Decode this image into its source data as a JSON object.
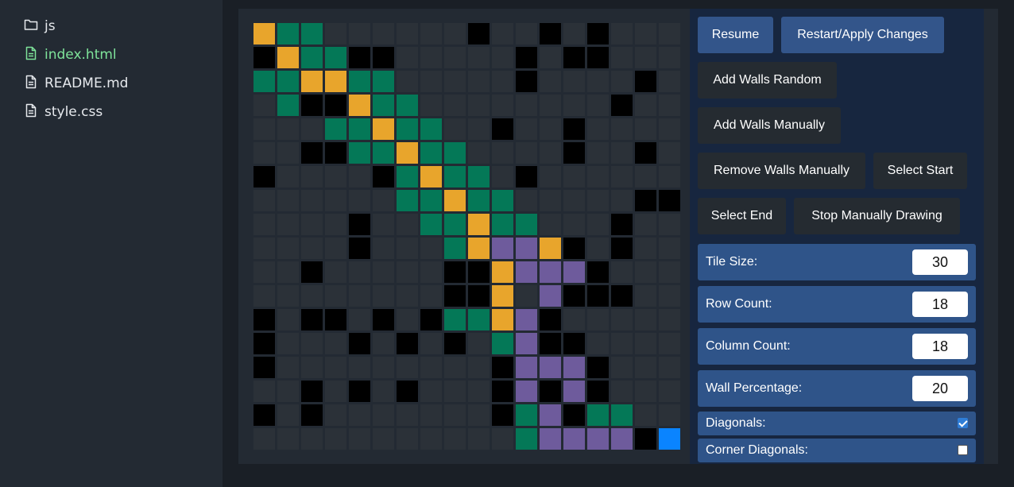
{
  "sidebar": {
    "files": [
      {
        "name": "js",
        "icon": "folder-icon",
        "active": false
      },
      {
        "name": "index.html",
        "icon": "file-icon",
        "active": true
      },
      {
        "name": "README.md",
        "icon": "file-icon",
        "active": false
      },
      {
        "name": "style.css",
        "icon": "file-icon",
        "active": false
      }
    ]
  },
  "colors": {
    "empty": "#2b3138",
    "wall": "#000000",
    "visited": "#047857",
    "path": "#e8a52c",
    "frontier": "#6e5b9c",
    "end": "#0a84ff"
  },
  "grid": {
    "legend": {
      ".": "empty",
      "#": "wall",
      "g": "visited",
      "o": "path",
      "p": "frontier",
      "E": "end"
    },
    "rows": [
      "ogg......#..#.#..",
      "#ogg##.....#.##.",
      "ggoogg.....#....#.",
      ".g##ogg........#..",
      "...ggogg..#..#....",
      "..##ggogg....#..#.",
      "#....#gogg.#......",
      "......ggogg.....##",
      "....#..ggogg...#..",
      "....#...goppo#.#..",
      "..#.....##oppp#...",
      "........##o.p###..",
      "#.##.#.#ggop#.....",
      "#...#.#.#.gp##....",
      "#.........#ppp#...",
      "..#.#.#...#p#p#...",
      "#.#.......#gp#gg.",
      "...........gpppp#E"
    ]
  },
  "controls": {
    "resume": "Resume",
    "restart": "Restart/Apply Changes",
    "add_walls_random": "Add Walls Random",
    "add_walls_manually": "Add Walls Manually",
    "remove_walls_manually": "Remove Walls Manually",
    "select_start": "Select Start",
    "select_end": "Select End",
    "stop_drawing": "Stop Manually Drawing"
  },
  "settings": {
    "tile_size": {
      "label": "Tile Size:",
      "value": "30"
    },
    "row_count": {
      "label": "Row Count:",
      "value": "18"
    },
    "column_count": {
      "label": "Column Count:",
      "value": "18"
    },
    "wall_percentage": {
      "label": "Wall Percentage:",
      "value": "20"
    },
    "diagonals": {
      "label": "Diagonals:",
      "checked": true
    },
    "corner_diagonals": {
      "label": "Corner Diagonals:",
      "checked": false
    }
  }
}
